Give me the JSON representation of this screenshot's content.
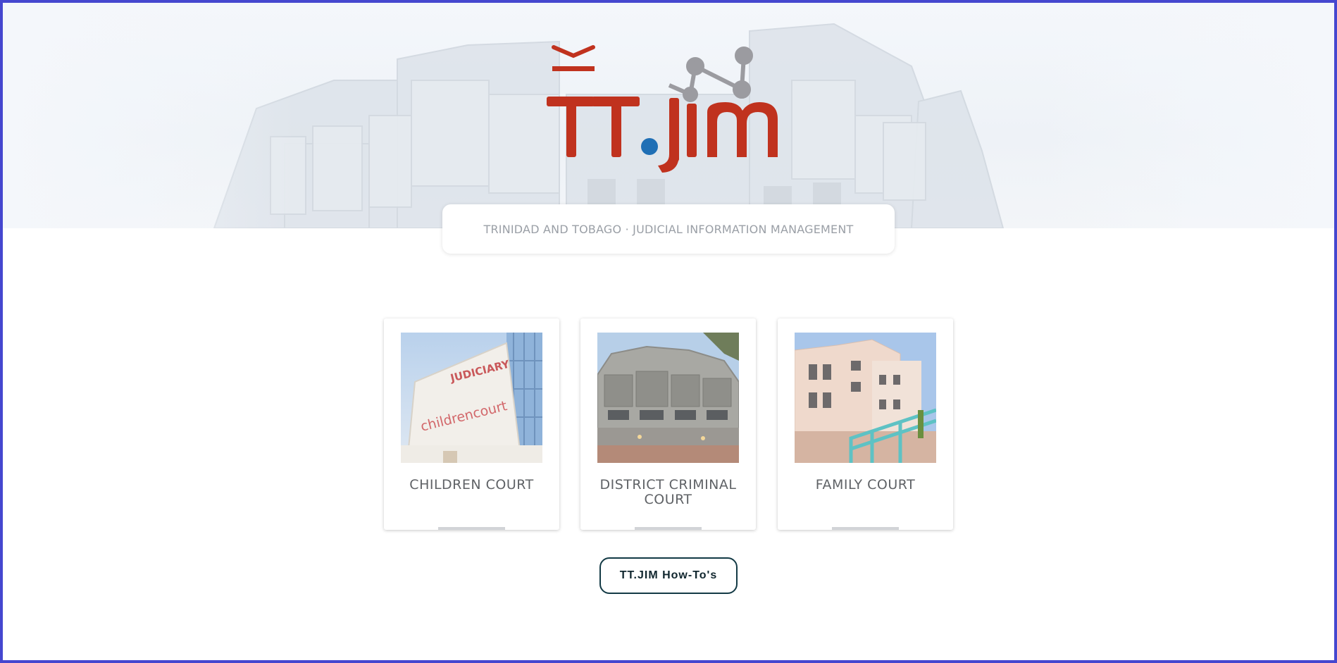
{
  "header": {
    "logo_text": "TT.jim",
    "tagline": "TRINIDAD AND TOBAGO · JUDICIAL INFORMATION MANAGEMENT"
  },
  "courts": [
    {
      "title": "CHILDREN COURT",
      "image": "children-court-building-photo",
      "sign_text": "JUDICIARY childrencourt"
    },
    {
      "title": "DISTRICT CRIMINAL COURT",
      "image": "district-criminal-court-building-photo"
    },
    {
      "title": "FAMILY COURT",
      "image": "family-court-building-photo"
    }
  ],
  "actions": {
    "howto_label": "TT.JIM How-To's"
  },
  "colors": {
    "border": "#4547cf",
    "logo_red": "#c0321e",
    "logo_blue": "#1f6fb5",
    "logo_gray": "#9b9ba0",
    "button_border": "#133a45"
  }
}
